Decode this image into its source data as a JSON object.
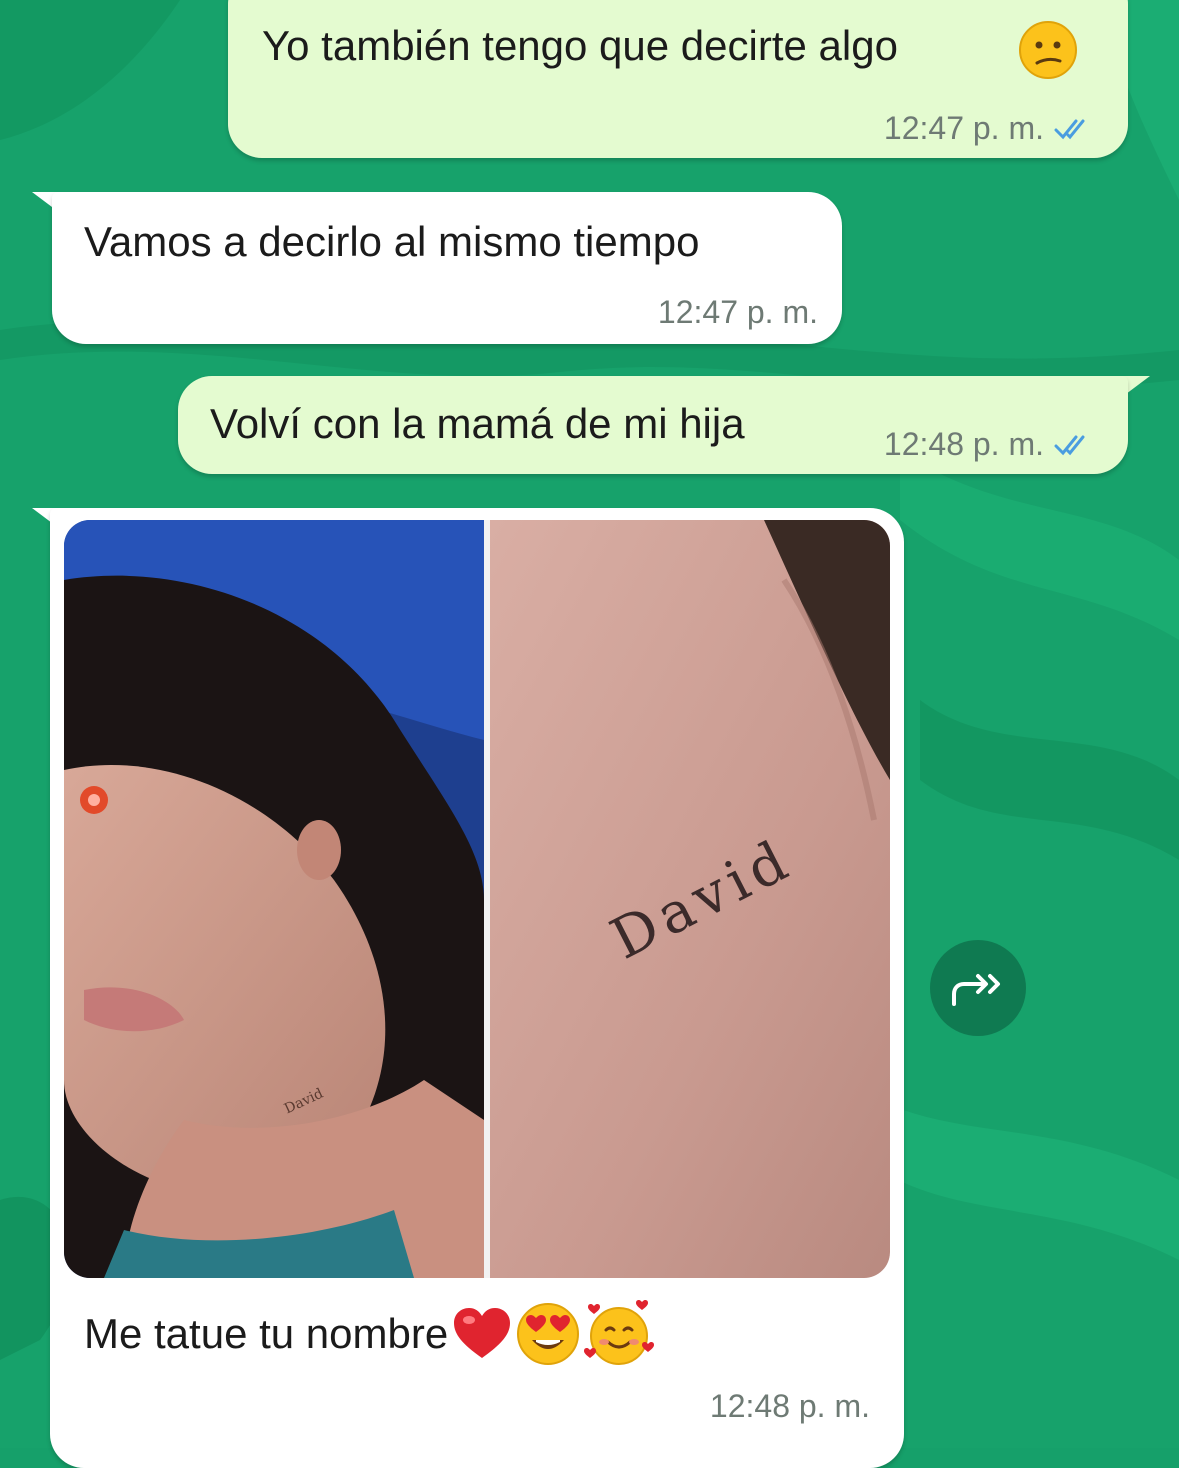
{
  "chat": {
    "messages": [
      {
        "direction": "outgoing",
        "text": "Yo también tengo que decirte algo",
        "emoji": "confused-face",
        "time": "12:47 p. m.",
        "status": "read"
      },
      {
        "direction": "incoming",
        "text": "Vamos a decirlo al mismo tiempo",
        "time": "12:47 p. m."
      },
      {
        "direction": "outgoing",
        "text": "Volví con la mamá de mi hija",
        "time": "12:48 p. m.",
        "status": "read"
      },
      {
        "direction": "incoming",
        "type": "image",
        "tattoo_text": "David",
        "caption": "Me tatue tu nombre",
        "emojis": [
          "red-heart",
          "heart-eyes-face",
          "smiling-face-with-hearts"
        ],
        "time": "12:48 p. m."
      }
    ],
    "forward_button": {
      "icon": "forward-icon"
    }
  },
  "colors": {
    "wallpaper": "#16a06a",
    "outgoing_bubble": "#e4fbd0",
    "incoming_bubble": "#ffffff",
    "read_ticks": "#4a9de0"
  }
}
